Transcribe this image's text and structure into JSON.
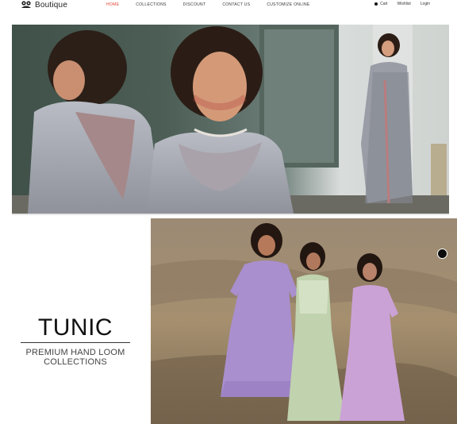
{
  "header": {
    "brand": "Boutique",
    "nav": [
      {
        "label": "Home",
        "active": true
      },
      {
        "label": "Collections",
        "active": false
      },
      {
        "label": "Discount",
        "active": false
      },
      {
        "label": "Contact Us",
        "active": false
      },
      {
        "label": "Customize Online",
        "active": false
      }
    ],
    "utilities": {
      "cart": "Cart",
      "wishlist": "Wishlist",
      "login": "Login"
    },
    "accent_color": "#e0402c"
  },
  "hero": {
    "image": "saree-model-hero"
  },
  "feature": {
    "title": "TUNIC",
    "subtitle_line1": "PREMIUM HAND LOOM",
    "subtitle_line2": "COLLECTIONS",
    "image": "three-girls-in-frocks"
  },
  "icons": [
    "logo-icon",
    "cart-dot-icon",
    "carousel-dot-icon"
  ]
}
